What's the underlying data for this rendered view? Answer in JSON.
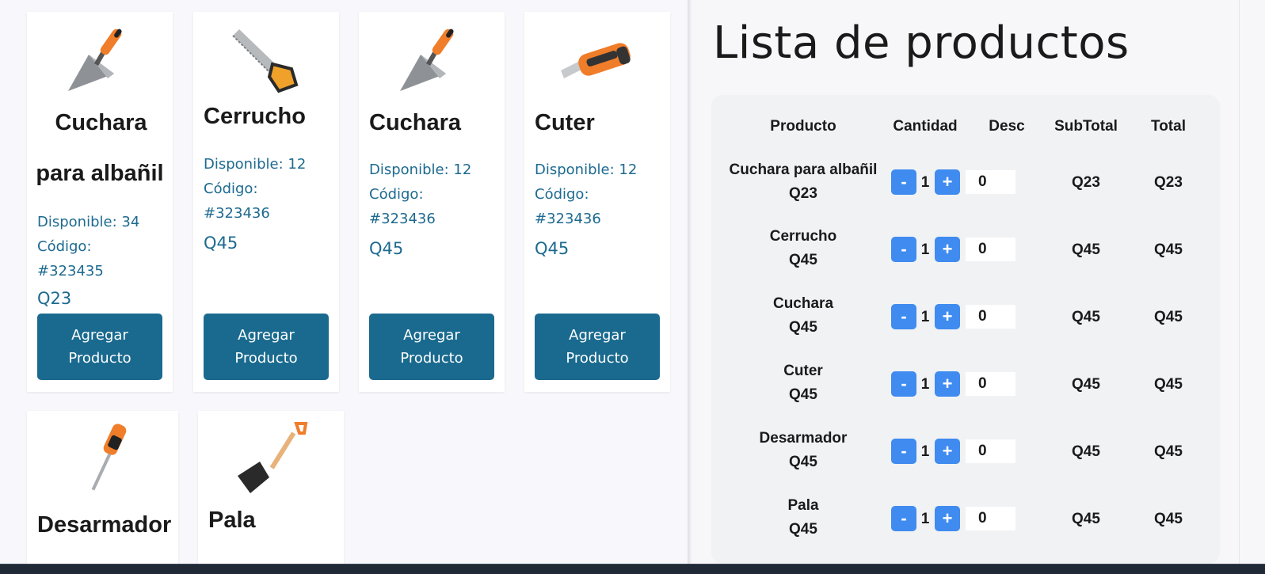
{
  "cards": [
    {
      "name_line1": "Cuchara",
      "name_line2": "para albañil",
      "available": "Disponible: 34",
      "code_label": "Código:",
      "code": "#323435",
      "price": "Q23",
      "button": "Agregar Producto",
      "icon": "trowel-icon"
    },
    {
      "name": "Cerrucho",
      "available": "Disponible: 12",
      "code_label": "Código:",
      "code": "#323436",
      "price": "Q45",
      "button": "Agregar Producto",
      "icon": "saw-icon"
    },
    {
      "name": "Cuchara",
      "available": "Disponible: 12",
      "code_label": "Código:",
      "code": "#323436",
      "price": "Q45",
      "button": "Agregar Producto",
      "icon": "trowel-icon"
    },
    {
      "name": "Cuter",
      "available": "Disponible: 12",
      "code_label": "Código:",
      "code": "#323436",
      "price": "Q45",
      "button": "Agregar Producto",
      "icon": "cutter-knife-icon"
    },
    {
      "name": "Desarmador",
      "icon": "screwdriver-icon"
    },
    {
      "name": "Pala",
      "icon": "shovel-icon"
    }
  ],
  "cart": {
    "title": "Lista de productos",
    "headers": [
      "Producto",
      "Cantidad",
      "Desc",
      "SubTotal",
      "Total"
    ],
    "minus_label": "-",
    "plus_label": "+",
    "rows": [
      {
        "name": "Cuchara para albañil",
        "price": "Q23",
        "qty": "1",
        "desc": "0",
        "subtotal": "Q23",
        "total": "Q23"
      },
      {
        "name": "Cerrucho",
        "price": "Q45",
        "qty": "1",
        "desc": "0",
        "subtotal": "Q45",
        "total": "Q45"
      },
      {
        "name": "Cuchara",
        "price": "Q45",
        "qty": "1",
        "desc": "0",
        "subtotal": "Q45",
        "total": "Q45"
      },
      {
        "name": "Cuter",
        "price": "Q45",
        "qty": "1",
        "desc": "0",
        "subtotal": "Q45",
        "total": "Q45"
      },
      {
        "name": "Desarmador",
        "price": "Q45",
        "qty": "1",
        "desc": "0",
        "subtotal": "Q45",
        "total": "Q45"
      },
      {
        "name": "Pala",
        "price": "Q45",
        "qty": "1",
        "desc": "0",
        "subtotal": "Q45",
        "total": "Q45"
      }
    ]
  },
  "colors": {
    "accent": "#1a6a8f",
    "qty_button": "#3f8bf0",
    "info_text": "#1d6a90"
  }
}
